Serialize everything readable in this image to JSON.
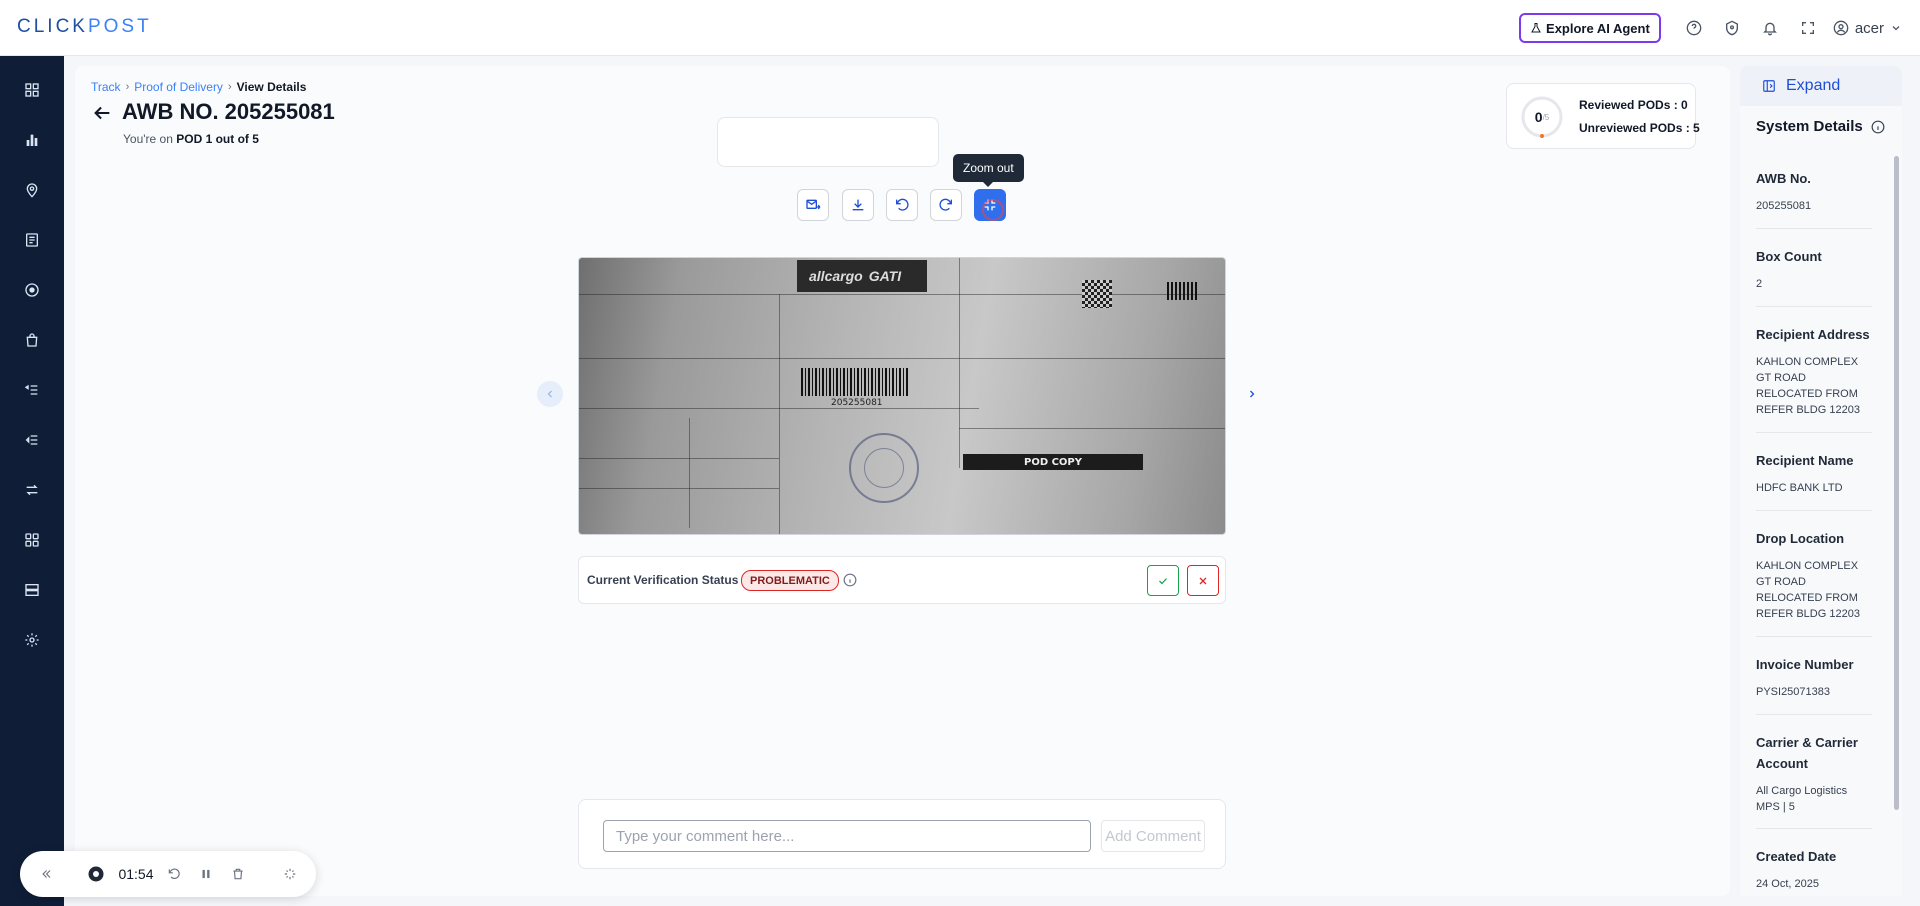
{
  "header": {
    "logo_part1": "CLICK",
    "logo_part2": "POST",
    "ai_agent_label": "Explore AI Agent",
    "user_name": "acer"
  },
  "breadcrumb": {
    "items": [
      "Track",
      "Proof of Delivery"
    ],
    "current": "View Details"
  },
  "page": {
    "title": "AWB NO. 205255081",
    "sub_prefix": "You're on ",
    "sub_strong": "POD 1 out of 5"
  },
  "pod_stats": {
    "reviewed_count": "0",
    "total": "/5",
    "reviewed_label": "Reviewed PODs : 0",
    "unreviewed_label": "Unreviewed PODs : 5",
    "progress_fraction": 0
  },
  "toolbar": {
    "tooltip": "Zoom out",
    "tools": [
      "email-icon",
      "download-icon",
      "rotate-left-icon",
      "rotate-right-icon",
      "zoom-out-icon"
    ]
  },
  "pod_image": {
    "brand": "allcargo",
    "brand_sub": "GATI",
    "barcode_number": "205255081",
    "pod_label": "POD COPY"
  },
  "verification": {
    "label": "Current Verification Status :",
    "status": "PROBLEMATIC"
  },
  "comment": {
    "placeholder": "Type your comment here...",
    "button": "Add Comment"
  },
  "right_panel": {
    "expand_label": "Expand",
    "title": "System Details",
    "fields": [
      {
        "label": "AWB No.",
        "value": "205255081"
      },
      {
        "label": "Box Count",
        "value": "2"
      },
      {
        "label": "Recipient Address",
        "value": "KAHLON COMPLEX GT ROAD RELOCATED FROM REFER BLDG 12203"
      },
      {
        "label": "Recipient Name",
        "value": "HDFC BANK LTD"
      },
      {
        "label": "Drop Location",
        "value": "KAHLON COMPLEX GT ROAD RELOCATED FROM REFER BLDG 12203"
      },
      {
        "label": "Invoice Number",
        "value": "PYSI25071383"
      },
      {
        "label": "Carrier & Carrier Account",
        "value": "All Cargo Logistics MPS | 5"
      },
      {
        "label": "Created Date",
        "value": "24 Oct, 2025"
      }
    ]
  },
  "recorder": {
    "time": "01:54"
  },
  "colors": {
    "nav_bg": "#0f1d37",
    "accent": "#2f6fed",
    "ai_border": "#7c3aed",
    "problem_red": "#dc2626",
    "approve_green": "#16a34a"
  }
}
